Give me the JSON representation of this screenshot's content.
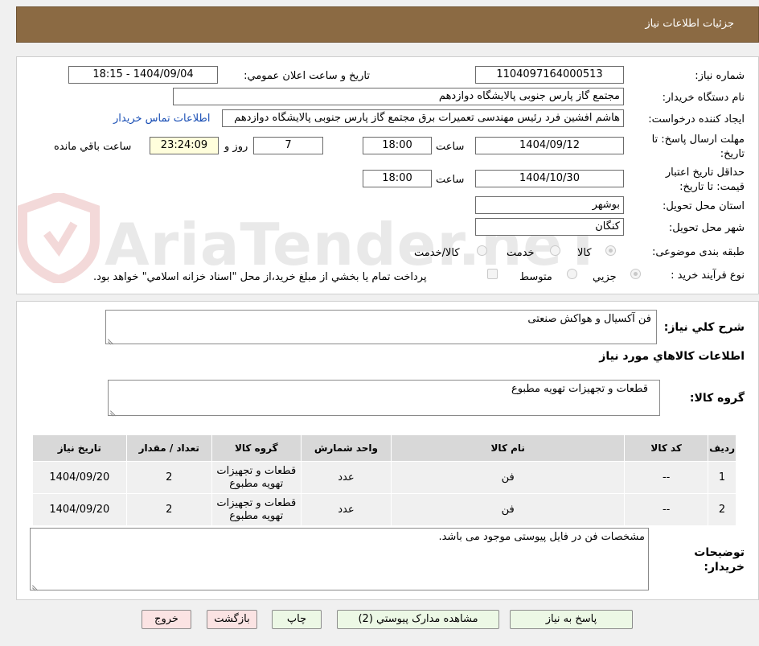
{
  "header": {
    "title": "جزئيات اطلاعات نياز"
  },
  "form": {
    "need_number_label": "شماره نياز:",
    "need_number": "1104097164000513",
    "announce_label": "تاريخ و ساعت اعلان عمومي:",
    "announce_value": "1404/09/04 - 18:15",
    "buyer_org_label": "نام دستگاه خريدار:",
    "buyer_org": "مجتمع گاز پارس جنوبی  پالایشگاه دوازدهم",
    "requester_label": "ايجاد کننده درخواست:",
    "requester": "هاشم افشین فرد رئیس مهندسی تعمیرات برق مجتمع گاز پارس جنوبی  پالایشگاه دوازدهم",
    "contact_link": "اطلاعات تماس خريدار",
    "reply_deadline_label": "مهلت ارسال پاسخ: تا تاريخ:",
    "reply_date": "1404/09/12",
    "time_label": "ساعت",
    "reply_time": "18:00",
    "days_value": "7",
    "days_label": "روز و",
    "remaining_time": "23:24:09",
    "remaining_label": "ساعت باقي مانده",
    "price_validity_label": "حداقل تاريخ اعتبار قيمت: تا تاريخ:",
    "validity_date": "1404/10/30",
    "validity_time": "18:00",
    "province_label": "استان محل تحويل:",
    "province": "بوشهر",
    "city_label": "شهر محل تحويل:",
    "city": "کنگان",
    "category_label": "طبقه بندی موضوعی:",
    "category_options": [
      "کالا",
      "خدمت",
      "کالا/خدمت"
    ],
    "process_label": "نوع فرآيند خريد :",
    "process_options": [
      "جزيي",
      "متوسط"
    ],
    "payment_note": "پرداخت تمام يا بخشي از مبلغ خريد،از محل \"اسناد خزانه اسلامي\" خواهد بود."
  },
  "watermark": "AriaTender.neT",
  "summary": {
    "general_desc_label": "شرح کلي نياز:",
    "general_desc": "فن آکسیال و هواکش صنعتی",
    "goods_info_title": "اطلاعات کالاهاي مورد نياز",
    "goods_group_label": "گروه کالا:",
    "goods_group": "قطعات و تجهیزات تهویه مطبوع"
  },
  "table": {
    "headers": [
      "رديف",
      "کد کالا",
      "نام کالا",
      "واحد شمارش",
      "گروه کالا",
      "تعداد / مقدار",
      "تاريخ نياز"
    ],
    "rows": [
      {
        "row": "1",
        "code": "--",
        "name": "فن",
        "unit": "عدد",
        "group1": "قطعات و تجهیزات",
        "group2": "تهویه مطبوع",
        "qty": "2",
        "date": "1404/09/20"
      },
      {
        "row": "2",
        "code": "--",
        "name": "فن",
        "unit": "عدد",
        "group1": "قطعات و تجهیزات",
        "group2": "تهویه مطبوع",
        "qty": "2",
        "date": "1404/09/20"
      }
    ]
  },
  "buyer_notes": {
    "label1": "توضيحات",
    "label2": "خريدار:",
    "text": "مشخصات فن در فایل پیوستی موجود می باشد."
  },
  "buttons": {
    "reply": "پاسخ به نياز",
    "attachments": "مشاهده مدارک پيوستي (2)",
    "print": "چاپ",
    "back": "بازگشت",
    "exit": "خروج"
  },
  "colors": {
    "header_bg": "#8b6a43",
    "button_green": "#ecf8e5",
    "button_pink": "#fbe3e3",
    "link": "#1a4fb5"
  }
}
